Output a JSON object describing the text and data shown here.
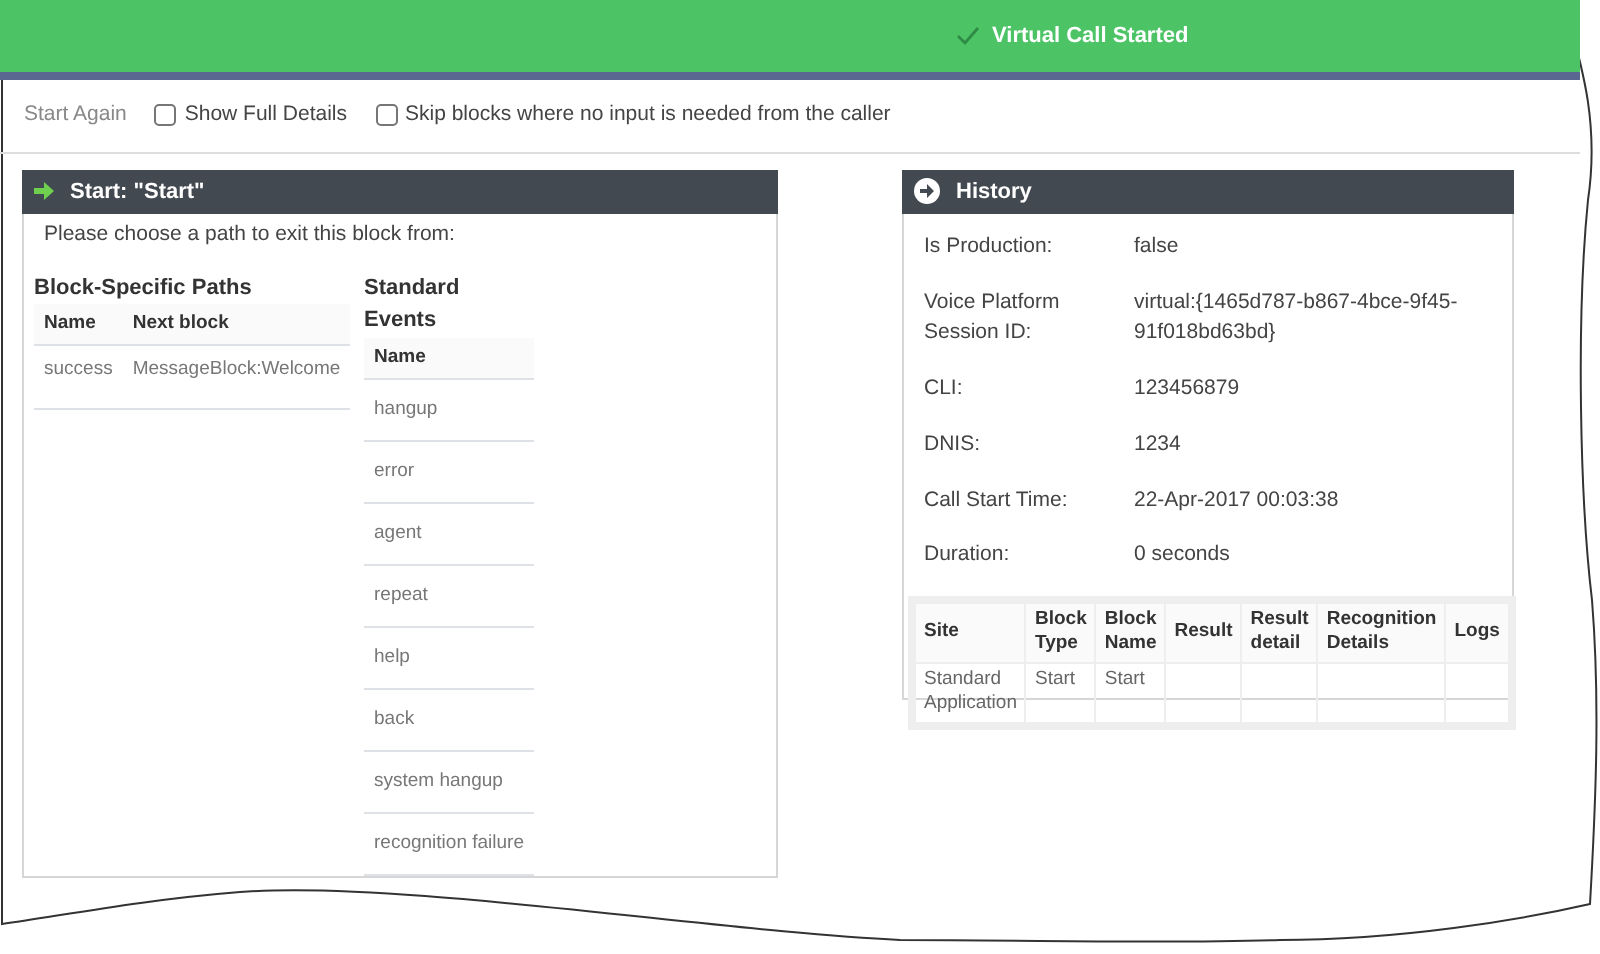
{
  "banner": {
    "text": "Virtual Call Started"
  },
  "toolbar": {
    "start_again": "Start Again",
    "options": [
      {
        "label": "Show Full Details",
        "checked": false
      },
      {
        "label": "Skip blocks where no input is needed from the caller",
        "checked": false
      }
    ]
  },
  "block_panel": {
    "title": "Start: \"Start\"",
    "prompt": "Please choose a path to exit this block from:",
    "paths": {
      "heading": "Block-Specific Paths",
      "columns": [
        "Name",
        "Next block"
      ],
      "rows": [
        [
          "success",
          "MessageBlock:Welcome"
        ]
      ]
    },
    "events": {
      "heading": "Standard Events",
      "columns": [
        "Name"
      ],
      "rows": [
        [
          "hangup"
        ],
        [
          "error"
        ],
        [
          "agent"
        ],
        [
          "repeat"
        ],
        [
          "help"
        ],
        [
          "back"
        ],
        [
          "system hangup"
        ],
        [
          "recognition failure"
        ]
      ]
    }
  },
  "history": {
    "title": "History",
    "fields": [
      {
        "label": "Is Production:",
        "value": "false"
      },
      {
        "label": "Voice Platform Session ID:",
        "value": "virtual:{1465d787-b867-4bce-9f45-91f018bd63bd}"
      },
      {
        "label": "CLI:",
        "value": "123456879"
      },
      {
        "label": "DNIS:",
        "value": "1234"
      },
      {
        "label": "Call Start Time:",
        "value": "22-Apr-2017 00:03:38"
      },
      {
        "label": "Duration:",
        "value": "0 seconds"
      }
    ],
    "table": {
      "columns": [
        "Site",
        "Block Type",
        "Block Name",
        "Result",
        "Result detail",
        "Recognition Details",
        "Logs"
      ],
      "rows": [
        [
          "Standard Application",
          "Start",
          "Start",
          "",
          "",
          "",
          ""
        ]
      ]
    }
  }
}
